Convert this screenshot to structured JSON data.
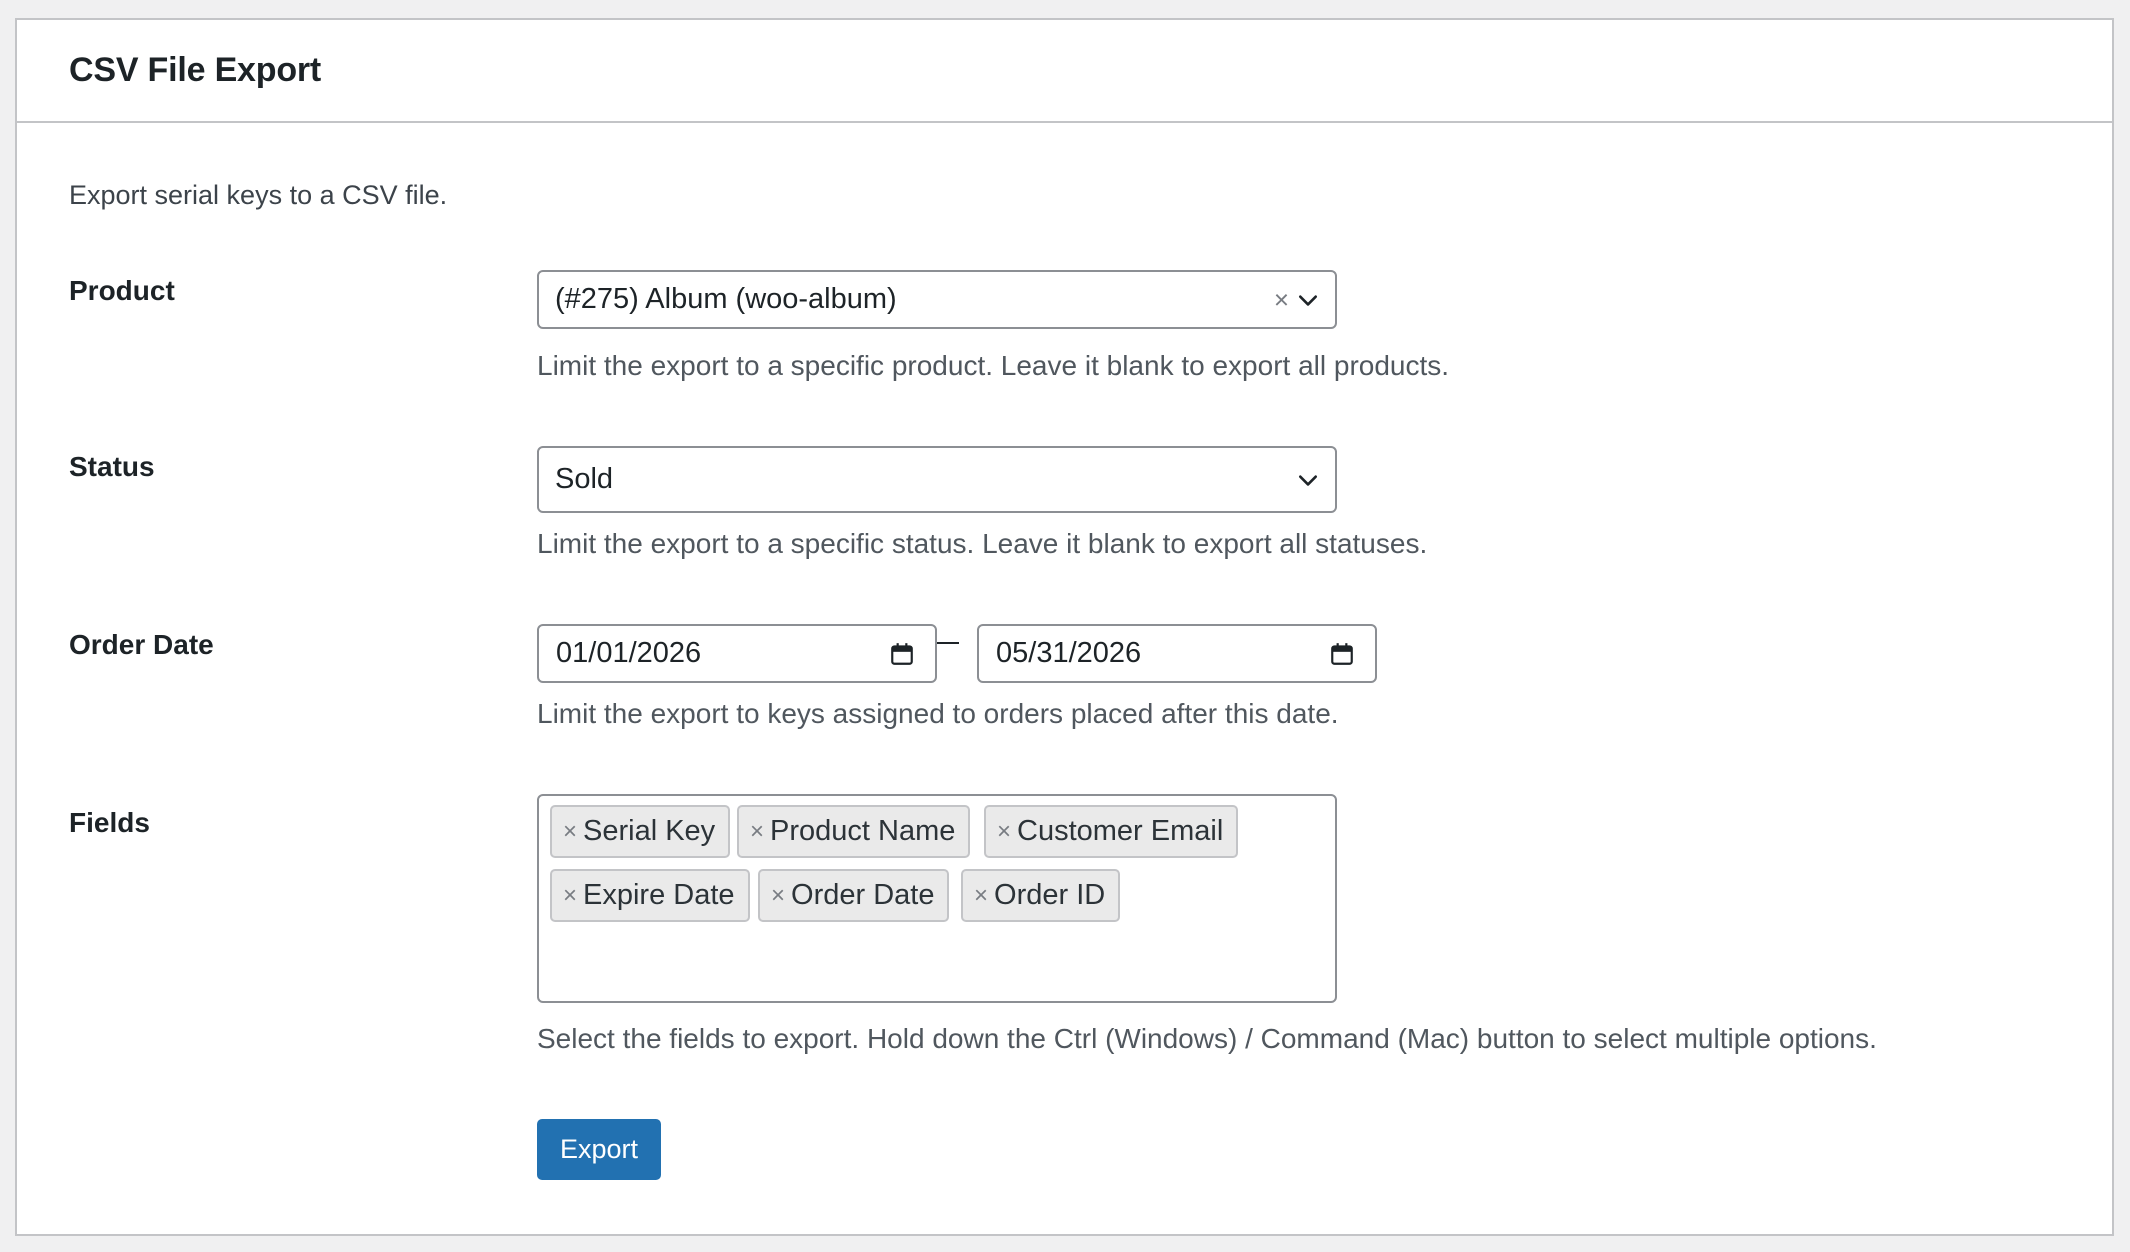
{
  "panel": {
    "title": "CSV File Export",
    "intro": "Export serial keys to a CSV file."
  },
  "product": {
    "label": "Product",
    "value": "(#275) Album (woo-album)",
    "clear_glyph": "×",
    "help": "Limit the export to a specific product. Leave it blank to export all products."
  },
  "status": {
    "label": "Status",
    "value": "Sold",
    "help": "Limit the export to a specific status. Leave it blank to export all statuses."
  },
  "order_date": {
    "label": "Order Date",
    "from": "01/01/2026",
    "to": "05/31/2026",
    "help": "Limit the export to keys assigned to orders placed after this date."
  },
  "fields": {
    "label": "Fields",
    "remove_glyph": "×",
    "selected": [
      "Serial Key",
      "Product Name",
      "Customer Email",
      "Expire Date",
      "Order Date",
      "Order ID"
    ],
    "help": "Select the fields to export. Hold down the Ctrl (Windows) / Command (Mac) button to select multiple options."
  },
  "actions": {
    "export_label": "Export"
  },
  "icons": {
    "dropdown": "chevron-down-icon",
    "date": "calendar-icon",
    "clear": "close-icon"
  },
  "colors": {
    "primary_button": "#2271b1",
    "border": "#8c8f94",
    "panel_border": "#c3c4c7",
    "help_text": "#50575e"
  }
}
